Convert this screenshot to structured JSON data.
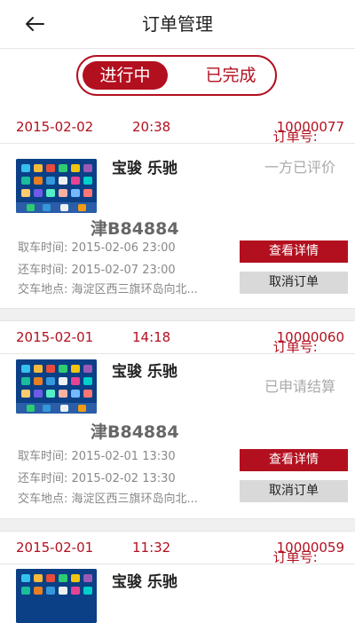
{
  "navbar": {
    "title": "订单管理",
    "back_icon": "back-arrow-icon"
  },
  "tabs": {
    "active": "进行中",
    "inactive": "已完成"
  },
  "labels": {
    "pickup": "取车时间:",
    "return": "还车时间:",
    "dropoff": "交车地点:",
    "order_no": "订单号:"
  },
  "buttons": {
    "detail": "查看详情",
    "cancel": "取消订单"
  },
  "orders": [
    {
      "date": "2015-02-02",
      "time": "20:38",
      "order_no": "10000077",
      "car": "宝骏 乐驰",
      "status": "一方已评价",
      "plate": "津B84884",
      "pickup_time": "2015-02-06 23:00",
      "return_time": "2015-02-07 23:00",
      "location": "海淀区西三旗环岛向北..."
    },
    {
      "date": "2015-02-01",
      "time": "14:18",
      "order_no": "10000060",
      "car": "宝骏 乐驰",
      "status": "已申请结算",
      "plate": "津B84884",
      "pickup_time": "2015-02-01 13:30",
      "return_time": "2015-02-02 13:30",
      "location": "海淀区西三旗环岛向北..."
    },
    {
      "date": "2015-02-01",
      "time": "11:32",
      "order_no": "10000059",
      "car": "宝骏 乐驰"
    }
  ],
  "colors": {
    "accent": "#b3101f",
    "muted": "#888888",
    "divider": "#e6e6e6"
  }
}
